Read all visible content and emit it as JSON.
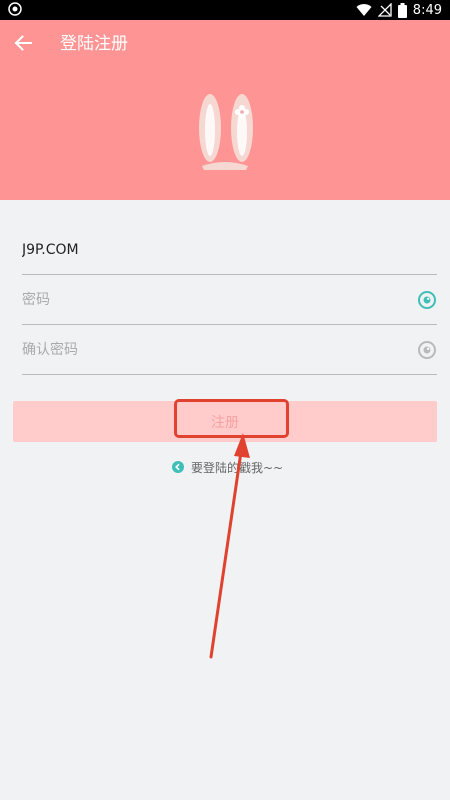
{
  "status_bar": {
    "time": "8:49",
    "icons": [
      "app-notification-icon",
      "wifi-icon",
      "no-signal-icon",
      "battery-icon"
    ]
  },
  "header": {
    "title": "登陆注册",
    "background_color": "#ff9494",
    "illustration": "bunny-ears-icon"
  },
  "form": {
    "username": {
      "value": "J9P.COM",
      "placeholder": ""
    },
    "password": {
      "value": "",
      "placeholder": "密码",
      "eye_color": "#3fbfb8"
    },
    "confirm_password": {
      "value": "",
      "placeholder": "确认密码",
      "eye_color": "#b9babc"
    }
  },
  "register_button": {
    "label": "注册",
    "background_color": "#ffcbcb"
  },
  "login_link": {
    "text": "要登陆的戳我~~",
    "icon": "chevron-left-icon",
    "icon_color": "#3fbfb8"
  },
  "annotation": {
    "highlight_color": "#e0422f",
    "target": "register_button"
  }
}
